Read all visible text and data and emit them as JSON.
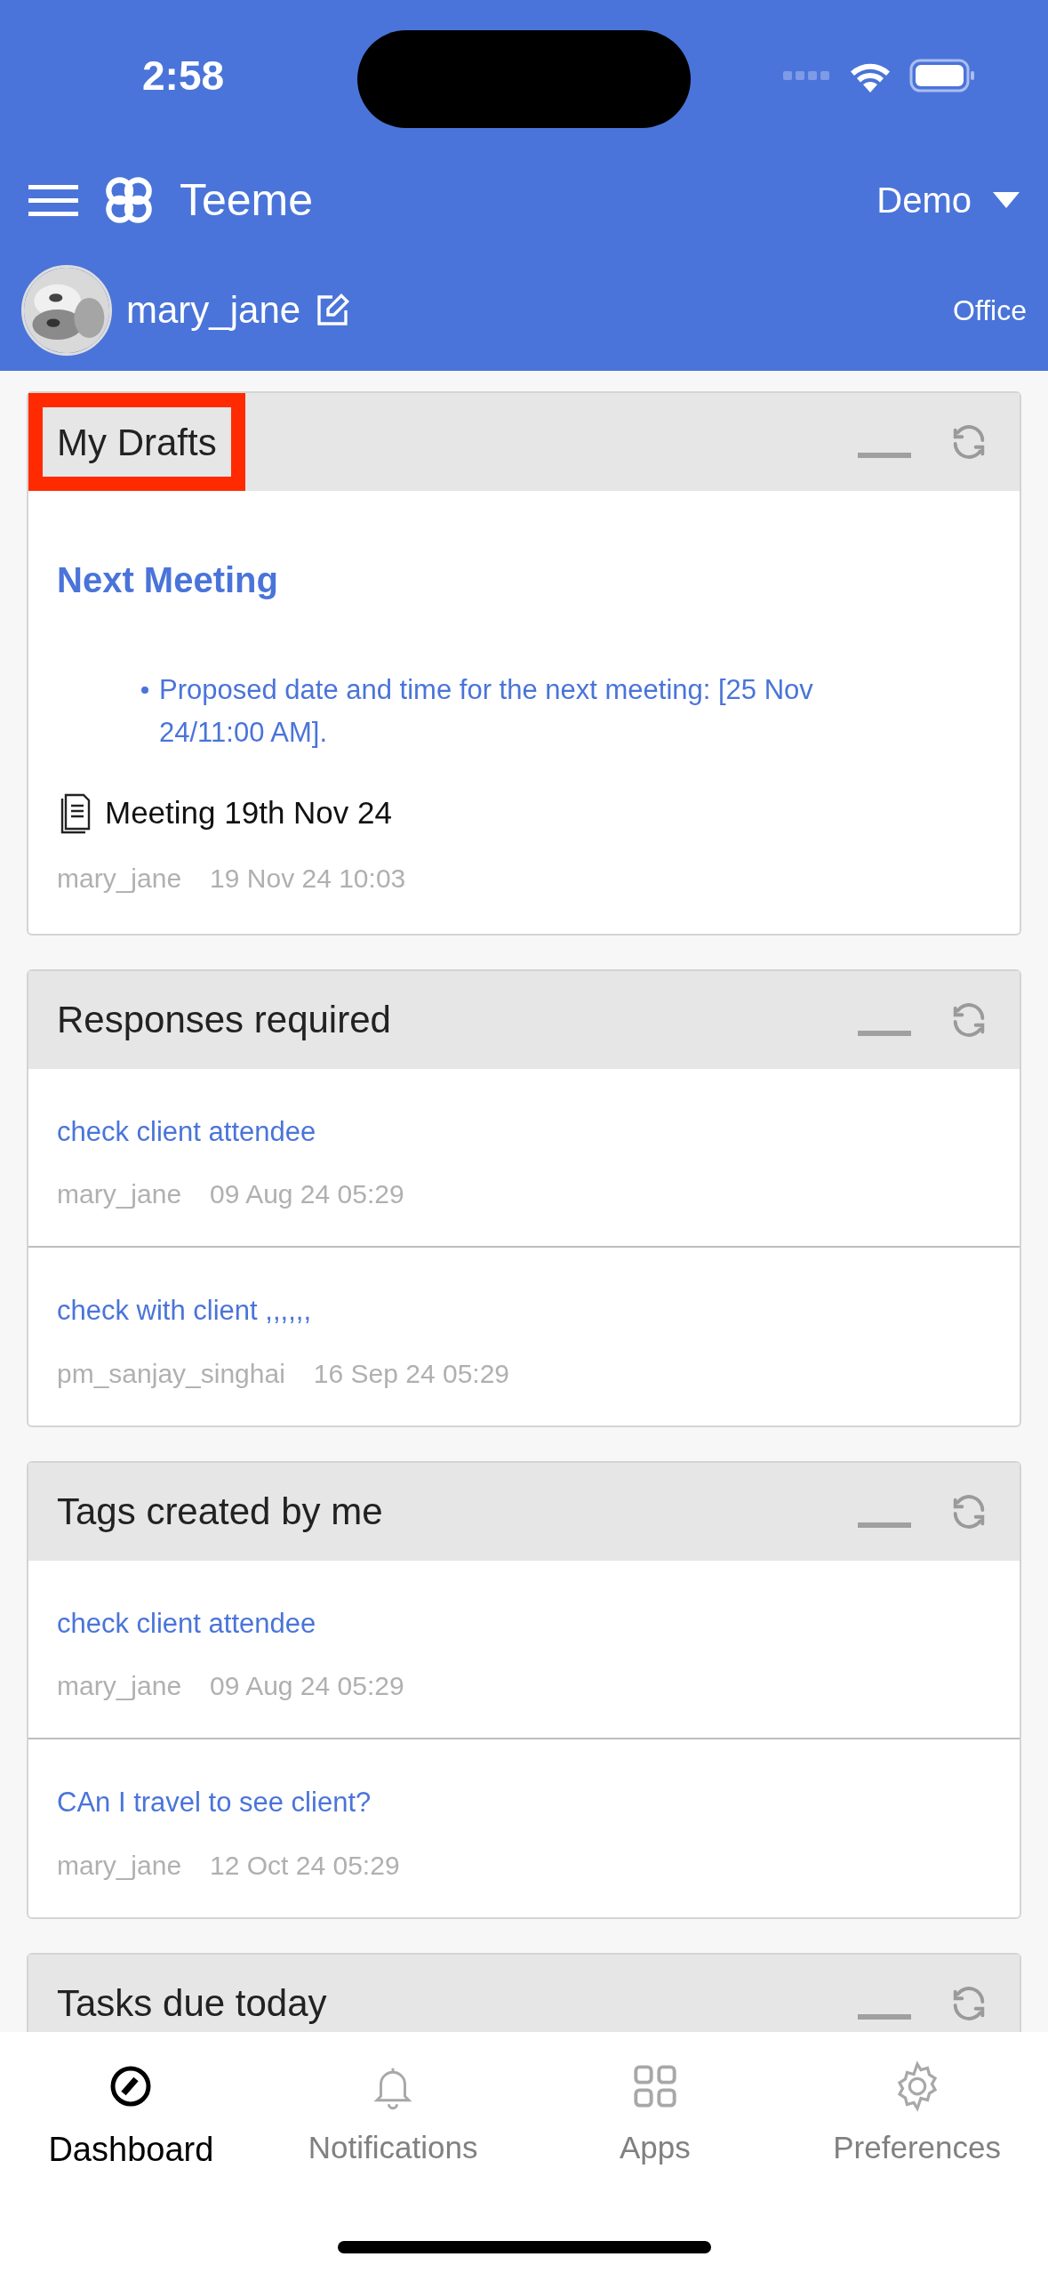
{
  "status_bar": {
    "time": "2:58"
  },
  "app_bar": {
    "title": "Teeme",
    "workspace": "Demo",
    "user": "mary_jane",
    "place": "Office"
  },
  "cards": [
    {
      "title": "My Drafts",
      "highlighted": true,
      "items": [
        {
          "kind": "draft",
          "heading": "Next Meeting",
          "bullet": "Proposed date and time for the next meeting: [25 Nov 24/11:00 AM].",
          "doc": "Meeting 19th Nov 24",
          "author": "mary_jane",
          "time": "19 Nov 24 10:03"
        }
      ]
    },
    {
      "title": "Responses required",
      "highlighted": false,
      "items": [
        {
          "kind": "link",
          "text": "check client attendee",
          "author": "mary_jane",
          "time": "09 Aug 24 05:29"
        },
        {
          "kind": "link",
          "text": "check with client ,,,,,,",
          "author": "pm_sanjay_singhai",
          "time": "16 Sep 24 05:29"
        }
      ]
    },
    {
      "title": "Tags created by me",
      "highlighted": false,
      "items": [
        {
          "kind": "link",
          "text": "check client attendee",
          "author": "mary_jane",
          "time": "09 Aug 24 05:29"
        },
        {
          "kind": "link",
          "text": "CAn I travel to see client?",
          "author": "mary_jane",
          "time": "12 Oct 24 05:29"
        }
      ]
    },
    {
      "title": "Tasks due today",
      "highlighted": false
    }
  ],
  "tabs": [
    {
      "label": "Dashboard",
      "selected": true
    },
    {
      "label": "Notifications",
      "selected": false
    },
    {
      "label": "Apps",
      "selected": false
    },
    {
      "label": "Preferences",
      "selected": false
    }
  ]
}
